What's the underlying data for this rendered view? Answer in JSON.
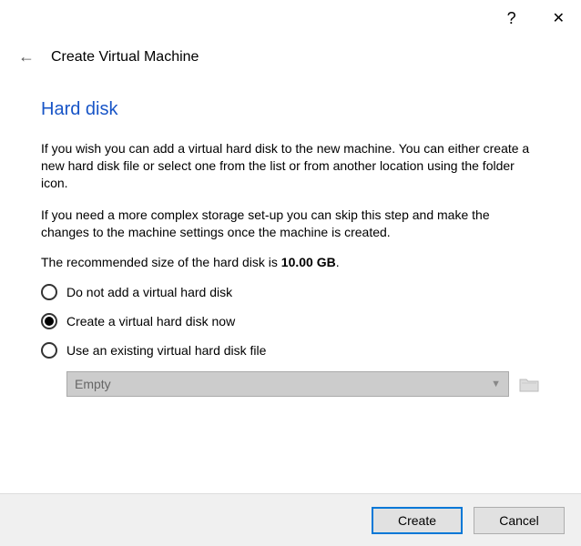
{
  "titlebar": {
    "help_symbol": "?",
    "close_symbol": "✕"
  },
  "header": {
    "back_symbol": "←",
    "title": "Create Virtual Machine"
  },
  "step": {
    "title": "Hard disk",
    "para1": "If you wish you can add a virtual hard disk to the new machine. You can either create a new hard disk file or select one from the list or from another location using the folder icon.",
    "para2": "If you need a more complex storage set-up you can skip this step and make the changes to the machine settings once the machine is created.",
    "reco_prefix": "The recommended size of the hard disk is ",
    "reco_value": "10.00 GB",
    "reco_suffix": "."
  },
  "options": [
    {
      "label": "Do not add a virtual hard disk",
      "selected": false
    },
    {
      "label": "Create a virtual hard disk now",
      "selected": true
    },
    {
      "label": "Use an existing virtual hard disk file",
      "selected": false
    }
  ],
  "dropdown": {
    "value": "Empty"
  },
  "footer": {
    "create": "Create",
    "cancel": "Cancel"
  }
}
